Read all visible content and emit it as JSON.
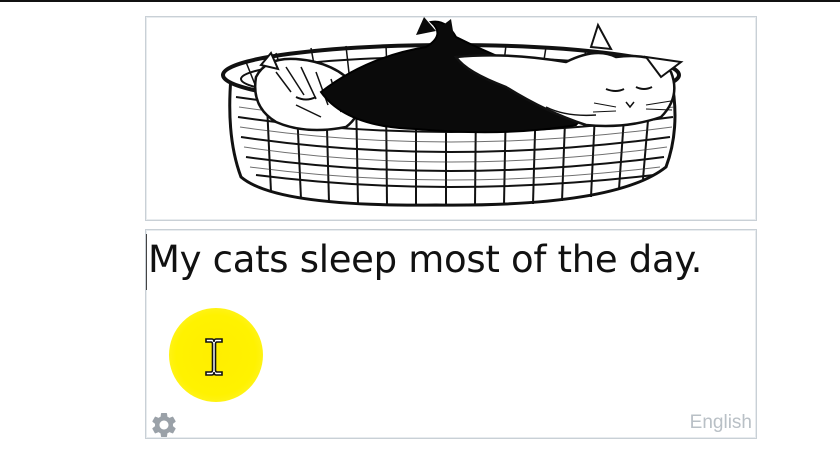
{
  "illustration": {
    "icon": "cats-in-basket-illustration"
  },
  "text_block": {
    "content": "My cats sleep most of the day."
  },
  "settings": {
    "icon": "gear-icon",
    "color": "#9aa1a8"
  },
  "language": {
    "label": "English",
    "color": "#b9c0c6"
  },
  "cursor_highlight": {
    "color": "#fff200"
  }
}
